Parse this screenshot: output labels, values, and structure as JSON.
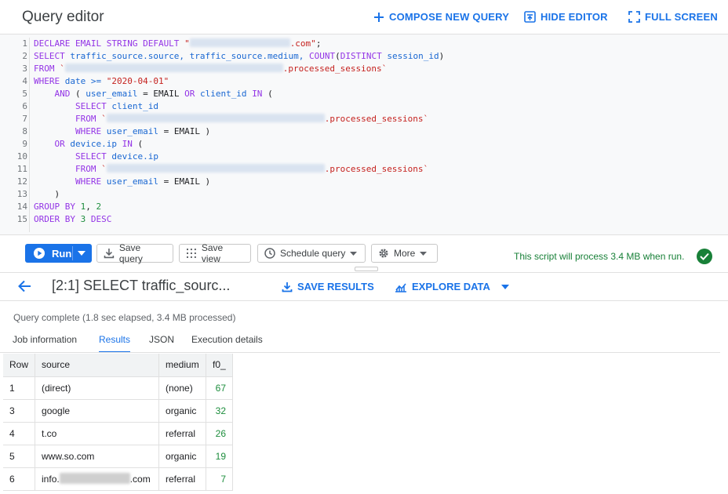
{
  "header": {
    "title": "Query editor",
    "compose_label": "COMPOSE NEW QUERY",
    "hide_label": "HIDE EDITOR",
    "fullscreen_label": "FULL SCREEN"
  },
  "editor": {
    "line_numbers": [
      "1",
      "2",
      "3",
      "4",
      "5",
      "6",
      "7",
      "8",
      "9",
      "10",
      "11",
      "12",
      "13",
      "14",
      "15"
    ],
    "lines": [
      [
        {
          "t": "DECLARE EMAIL STRING DEFAULT ",
          "c": "kw"
        },
        {
          "t": "\"",
          "c": "str"
        },
        {
          "b": 128
        },
        {
          "t": ".com\"",
          "c": "str"
        },
        {
          "t": ";",
          "c": "op"
        }
      ],
      [
        {
          "t": "SELECT ",
          "c": "kw"
        },
        {
          "t": "traffic_source.source, traffic_source.medium, ",
          "c": "id"
        },
        {
          "t": "COUNT",
          "c": "kw"
        },
        {
          "t": "(",
          "c": "op"
        },
        {
          "t": "DISTINCT ",
          "c": "kw"
        },
        {
          "t": "session_id",
          "c": "id"
        },
        {
          "t": ")",
          "c": "op"
        }
      ],
      [
        {
          "t": "FROM ",
          "c": "kw"
        },
        {
          "t": "`",
          "c": "str"
        },
        {
          "b": 278
        },
        {
          "t": ".processed_sessions`",
          "c": "str"
        }
      ],
      [
        {
          "t": "WHERE ",
          "c": "kw"
        },
        {
          "t": "date >= ",
          "c": "id"
        },
        {
          "t": "\"2020-04-01\"",
          "c": "str"
        }
      ],
      [
        {
          "t": "    AND ",
          "c": "kw"
        },
        {
          "t": "( ",
          "c": "op"
        },
        {
          "t": "user_email ",
          "c": "id"
        },
        {
          "t": "= EMAIL ",
          "c": "op"
        },
        {
          "t": "OR ",
          "c": "kw"
        },
        {
          "t": "client_id ",
          "c": "id"
        },
        {
          "t": "IN ",
          "c": "kw"
        },
        {
          "t": "(",
          "c": "op"
        }
      ],
      [
        {
          "t": "        SELECT ",
          "c": "kw"
        },
        {
          "t": "client_id",
          "c": "id"
        }
      ],
      [
        {
          "t": "        FROM ",
          "c": "kw"
        },
        {
          "t": "`",
          "c": "str"
        },
        {
          "b": 278
        },
        {
          "t": ".processed_sessions`",
          "c": "str"
        }
      ],
      [
        {
          "t": "        WHERE ",
          "c": "kw"
        },
        {
          "t": "user_email ",
          "c": "id"
        },
        {
          "t": "= EMAIL )",
          "c": "op"
        }
      ],
      [
        {
          "t": "    OR ",
          "c": "kw"
        },
        {
          "t": "device.ip ",
          "c": "id"
        },
        {
          "t": "IN ",
          "c": "kw"
        },
        {
          "t": "(",
          "c": "op"
        }
      ],
      [
        {
          "t": "        SELECT ",
          "c": "kw"
        },
        {
          "t": "device.ip",
          "c": "id"
        }
      ],
      [
        {
          "t": "        FROM ",
          "c": "kw"
        },
        {
          "t": "`",
          "c": "str"
        },
        {
          "b": 278
        },
        {
          "t": ".processed_sessions`",
          "c": "str"
        }
      ],
      [
        {
          "t": "        WHERE ",
          "c": "kw"
        },
        {
          "t": "user_email ",
          "c": "id"
        },
        {
          "t": "= EMAIL )",
          "c": "op"
        }
      ],
      [
        {
          "t": "    )",
          "c": "op"
        }
      ],
      [
        {
          "t": "GROUP BY ",
          "c": "kw"
        },
        {
          "t": "1",
          "c": "num"
        },
        {
          "t": ", ",
          "c": "op"
        },
        {
          "t": "2",
          "c": "num"
        }
      ],
      [
        {
          "t": "ORDER BY ",
          "c": "kw"
        },
        {
          "t": "3 ",
          "c": "num"
        },
        {
          "t": "DESC",
          "c": "kw"
        }
      ]
    ]
  },
  "toolbar": {
    "run_label": "Run",
    "save_query_label": "Save query",
    "save_view_label": "Save view",
    "schedule_label": "Schedule query",
    "more_label": "More",
    "process_message": "This script will process 3.4 MB when run."
  },
  "results": {
    "title": "[2:1] SELECT traffic_sourc...",
    "save_results_label": "SAVE RESULTS",
    "explore_label": "EXPLORE DATA",
    "status": "Query complete (1.8 sec elapsed, 3.4 MB processed)",
    "tabs": [
      "Job information",
      "Results",
      "JSON",
      "Execution details"
    ],
    "active_tab": "Results",
    "columns": [
      "Row",
      "source",
      "medium",
      "f0_"
    ],
    "rows": [
      {
        "row": "1",
        "source": "(direct)",
        "source_blur": false,
        "source_suffix": "",
        "medium": "(none)",
        "f0": "67"
      },
      {
        "row": "3",
        "source": "google",
        "source_blur": false,
        "source_suffix": "",
        "medium": "organic",
        "f0": "32"
      },
      {
        "row": "4",
        "source": "t.co",
        "source_blur": false,
        "source_suffix": "",
        "medium": "referral",
        "f0": "26"
      },
      {
        "row": "5",
        "source": "www.so.com",
        "source_blur": false,
        "source_suffix": "",
        "medium": "organic",
        "f0": "19"
      },
      {
        "row": "6",
        "source": "info.",
        "source_blur": true,
        "source_suffix": ".com",
        "medium": "referral",
        "f0": "7"
      }
    ]
  },
  "colors": {
    "accent": "#1a73e8",
    "success": "#188038",
    "keyword": "#9334e6",
    "identifier": "#1967d2",
    "string": "#c5221f",
    "number": "#1e8e3e"
  }
}
